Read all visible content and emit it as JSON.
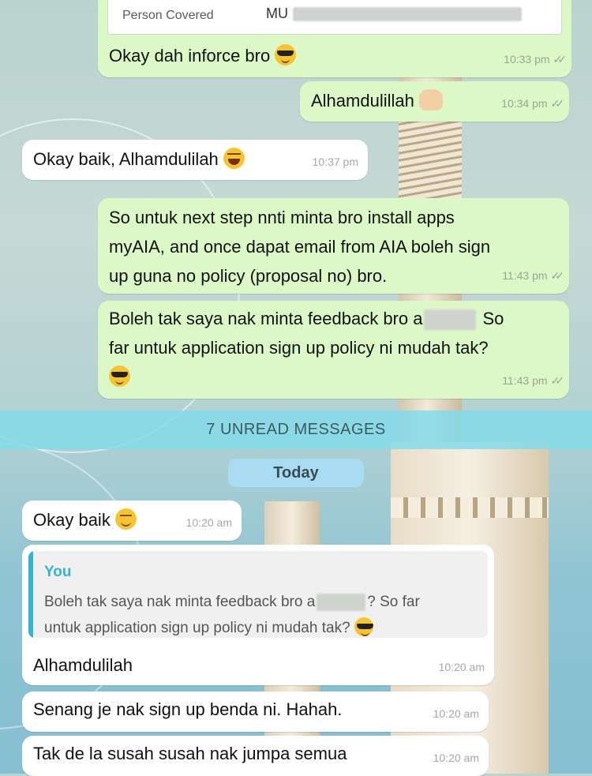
{
  "top_card": {
    "label": "Person Covered",
    "value_prefix": "MU"
  },
  "messages": [
    {
      "side": "out",
      "text": "Okay dah inforce bro",
      "emoji": "cool-emoji",
      "time": "10:33 pm"
    },
    {
      "side": "out",
      "text": "Alhamdulillah",
      "emoji": "raised-hands-emoji",
      "time": "10:34 pm"
    },
    {
      "side": "in",
      "text": "Okay baik, Alhamdulilah",
      "emoji": "laugh-emoji",
      "time": "10:37 pm"
    },
    {
      "side": "out",
      "lines": [
        "So untuk next step nnti minta bro install apps",
        "myAIA, and once dapat email from AIA boleh sign",
        "up guna no policy (proposal no) bro."
      ],
      "time": "11:43 pm"
    },
    {
      "side": "out",
      "lines": [
        "Boleh tak saya nak minta feedback bro a",
        "So",
        "far untuk application sign up policy ni mudah tak?"
      ],
      "emoji": "cool-emoji",
      "time": "11:43 pm"
    }
  ],
  "unread_banner": "7 UNREAD MESSAGES",
  "date_chip": "Today",
  "new_messages": [
    {
      "side": "in",
      "text": "Okay baik",
      "emoji": "smile-emoji",
      "time": "10:20 am"
    },
    {
      "side": "in",
      "reply_to": {
        "author": "You",
        "line1": "Boleh tak saya nak minta feedback bro a",
        "line1_end": "? So far",
        "line2": "untuk application sign up policy ni mudah tak?"
      },
      "text": "Alhamdulilah",
      "time": "10:20 am"
    },
    {
      "side": "in",
      "text": "Senang je nak sign up benda ni. Hahah.",
      "time": "10:20 am"
    },
    {
      "side": "in",
      "text": "Tak de la susah susah nak jumpa semua",
      "time": "10:20 am"
    }
  ],
  "status": {
    "read_ticks": "✓✓"
  }
}
